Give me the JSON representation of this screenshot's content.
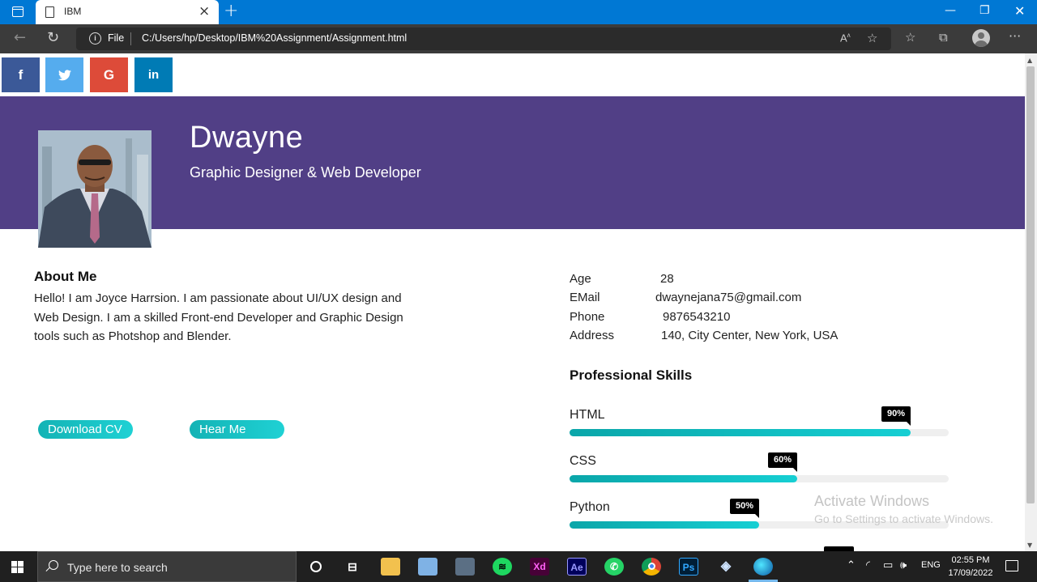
{
  "browser": {
    "tab_title": "IBM",
    "protocol_label": "File",
    "url": "C:/Users/hp/Desktop/IBM%20Assignment/Assignment.html"
  },
  "social": [
    {
      "label": "f",
      "color": "#3b5998"
    },
    {
      "label": "t",
      "color": "#55acee"
    },
    {
      "label": "G",
      "color": "#dd4b39"
    },
    {
      "label": "in",
      "color": "#007bb5"
    }
  ],
  "profile": {
    "name": "Dwayne",
    "role": "Graphic Designer & Web Developer",
    "about_heading": "About Me",
    "about_text": "Hello! I am Joyce Harrsion. I am passionate about UI/UX design and Web Design. I am a skilled Front-end Developer and Graphic Design tools such as Photshop and Blender.",
    "download_cv_label": "Download CV",
    "hear_me_label": "Hear Me"
  },
  "info": {
    "age_label": "Age",
    "age_value": "28",
    "email_label": "EMail",
    "email_value": "dwaynejana75@gmail.com",
    "phone_label": "Phone",
    "phone_value": "9876543210",
    "address_label": "Address",
    "address_value": "140, City Center, New York, USA"
  },
  "skills": {
    "heading": "Professional Skills",
    "items": [
      {
        "name": "HTML",
        "percent_label": "90%",
        "level": 0.9
      },
      {
        "name": "CSS",
        "percent_label": "60%",
        "level": 0.6
      },
      {
        "name": "Python",
        "percent_label": "50%",
        "level": 0.5
      }
    ]
  },
  "watermark": {
    "line1": "Activate Windows",
    "line2": "Go to Settings to activate Windows."
  },
  "taskbar": {
    "search_placeholder": "Type here to search",
    "language": "ENG",
    "time": "02:55 PM",
    "date": "17/09/2022"
  }
}
